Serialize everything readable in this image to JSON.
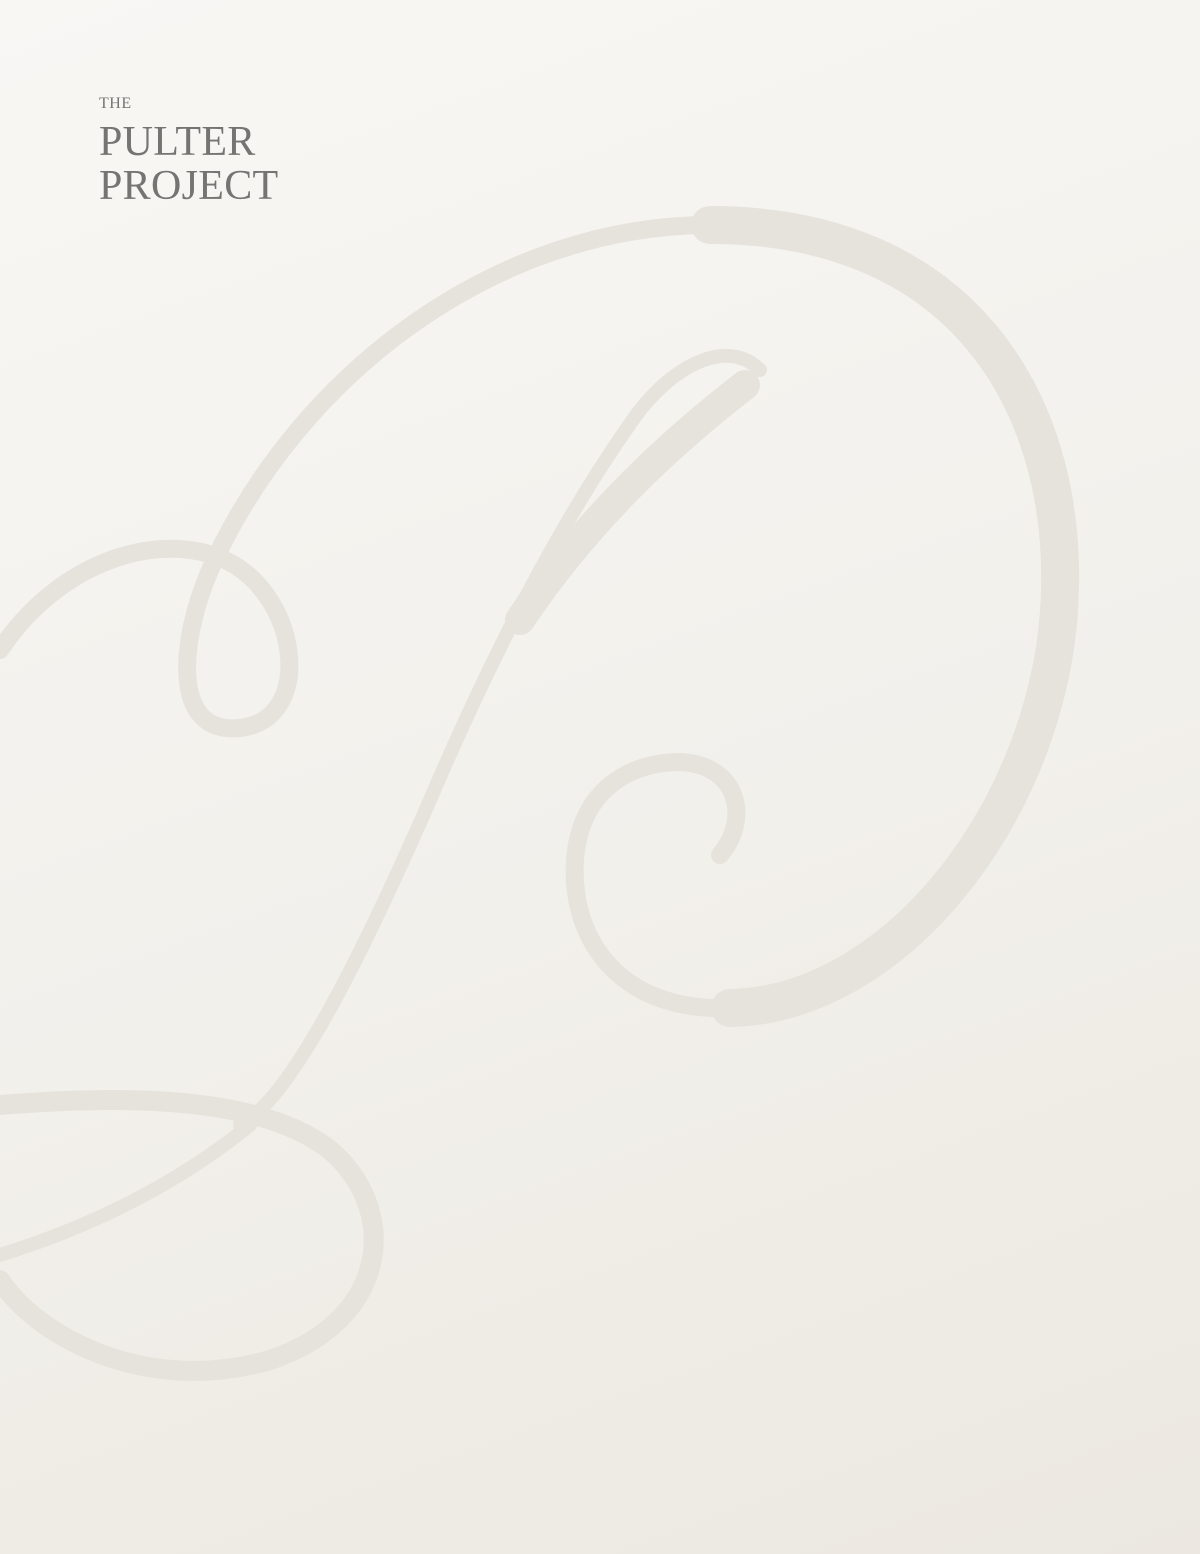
{
  "logo": {
    "the": "THE",
    "line1": "PULTER",
    "line2": "PROJECT",
    "text_color": "#767472"
  },
  "watermark": {
    "icon": "script-letter-p-flourish",
    "stroke_color": "#e6e3dd"
  },
  "colors": {
    "background_top": "#f8f7f4",
    "background_bottom": "#ece8e1"
  }
}
